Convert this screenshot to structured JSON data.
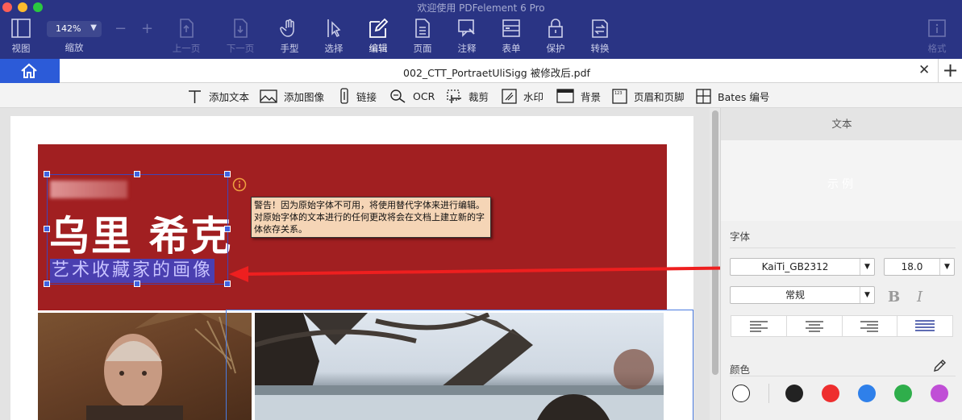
{
  "app": {
    "title": "欢迎使用 PDFelement 6 Pro"
  },
  "colors": {
    "toolbar_bg": "#2a3484",
    "accent": "#2c5bd8",
    "banner_red": "#a11f21",
    "tooltip_bg": "#f5d5b6"
  },
  "toolbar": {
    "view_label": "视图",
    "zoom_value": "142%",
    "zoom_label": "缩放",
    "zoom_out": "−",
    "zoom_in": "+",
    "prev_label": "上一页",
    "next_label": "下一页",
    "hand_label": "手型",
    "select_label": "选择",
    "edit_label": "编辑",
    "page_label": "页面",
    "comment_label": "注释",
    "form_label": "表单",
    "protect_label": "保护",
    "convert_label": "转换",
    "format_label": "格式"
  },
  "tab": {
    "title": "002_CTT_PortraetUliSigg 被修改后.pdf",
    "close": "✕",
    "add": "+"
  },
  "edit_tools": {
    "add_text": "添加文本",
    "add_image": "添加图像",
    "link": "链接",
    "ocr": "OCR",
    "crop": "裁剪",
    "watermark": "水印",
    "background": "背景",
    "header_footer": "页眉和页脚",
    "bates": "Bates 编号"
  },
  "document": {
    "headline": "乌里 希克",
    "subtitle": "艺术收藏家的画像",
    "warning": "警告！因为原始字体不可用，将使用替代字体来进行编辑。对原始字体的文本进行的任何更改将会在文档上建立新的字体依存关系。"
  },
  "panel": {
    "header": "文本",
    "preview_text": "示例",
    "font_section": "字体",
    "font_name": "KaiTi_GB2312",
    "font_size": "18.0",
    "font_style": "常规",
    "bold": "B",
    "italic": "I",
    "color_section": "颜色",
    "swatches": [
      "#ffffff",
      "#222222",
      "#ee2e2e",
      "#2f80ea",
      "#2fae4b",
      "#c04fd6"
    ]
  }
}
